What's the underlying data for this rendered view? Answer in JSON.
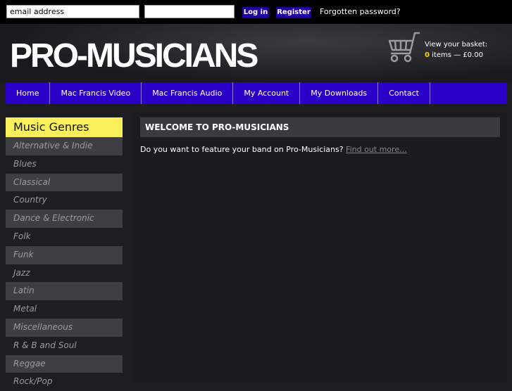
{
  "topbar": {
    "email_value": "email address",
    "login_label": "Log in",
    "register_label": "Register",
    "forgot_label": "Forgotten password?"
  },
  "header": {
    "logo_text": "PRO-MUSICIANS",
    "basket_label": "View your basket:",
    "basket_count": "0",
    "basket_summary": "items — £0.00"
  },
  "nav": {
    "items": [
      "Home",
      "Mac Francis Video",
      "Mac Francis Audio",
      "My Account",
      "My Downloads",
      "Contact"
    ]
  },
  "sidebar": {
    "title": "Music Genres",
    "genres": [
      "Alternative & Indie",
      "Blues",
      "Classical",
      "Country",
      "Dance & Electronic",
      "Folk",
      "Funk",
      "Jazz",
      "Latin",
      "Metal",
      "Miscellaneous",
      "R & B and Soul",
      "Reggae",
      "Rock/Pop"
    ]
  },
  "main": {
    "heading": "WELCOME TO PRO-MUSICIANS",
    "feature_text": "Do you want to feature your band on Pro-Musicians?",
    "feature_link": "Find out more..."
  },
  "colors": {
    "nav_bg": "#2a00c8",
    "button_bg": "#2200a0",
    "genres_title_bg": "#f8ef5a",
    "basket_count": "#ffd400"
  }
}
